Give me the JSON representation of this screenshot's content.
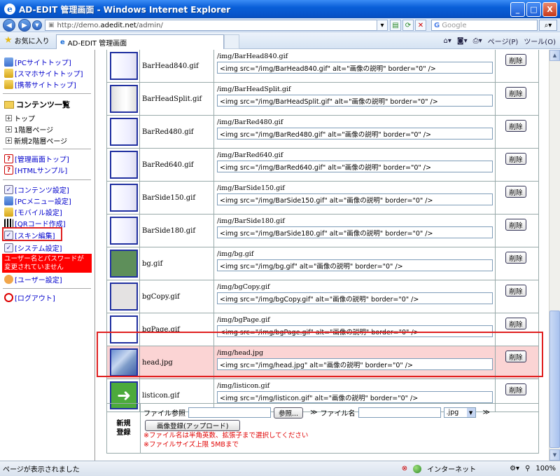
{
  "window": {
    "title": "AD-EDIT 管理画面 - Windows Internet Explorer",
    "min": "_",
    "max": "□",
    "close": "X"
  },
  "address": {
    "url_prefix": "http://demo.",
    "url_domain": "adedit.net",
    "url_suffix": "/admin/",
    "search_placeholder": "Google"
  },
  "favorites": {
    "label": "お気に入り"
  },
  "tab": {
    "label": "AD-EDIT 管理画面"
  },
  "toolbar": {
    "page": "ページ(P)",
    "tools": "ツール(O)"
  },
  "sidebar": {
    "top_links": [
      "[PCサイトトップ]",
      "[スマホサイトトップ]",
      "[携帯サイトトップ]"
    ],
    "contents_title": "コンテンツ一覧",
    "tree": [
      "トップ",
      "1階層ページ",
      "新規2階層ページ"
    ],
    "admin_links": [
      "[管理画面トップ]",
      "[HTMLサンプル]"
    ],
    "settings_links": [
      "[コンテンツ設定]",
      "[PCメニュー設定]",
      "[モバイル設定]",
      "[QRコード作成]",
      "[スキン編集]",
      "[システム設定]"
    ],
    "warning": "ユーザー名とパスワードが変更されていません",
    "user_link": "[ユーザー設定]",
    "logout_link": "[ログアウト]"
  },
  "images": [
    {
      "name": "BarHead840.gif",
      "path": "/img/BarHead840.gif",
      "code": "<img src=\"/img/BarHead840.gif\" alt=\"画像の説明\" border=\"0\" />",
      "thumb": "grad1"
    },
    {
      "name": "BarHeadSplit.gif",
      "path": "/img/BarHeadSplit.gif",
      "code": "<img src=\"/img/BarHeadSplit.gif\" alt=\"画像の説明\" border=\"0\" />",
      "thumb": "split"
    },
    {
      "name": "BarRed480.gif",
      "path": "/img/BarRed480.gif",
      "code": "<img src=\"/img/BarRed480.gif\" alt=\"画像の説明\" border=\"0\" />",
      "thumb": "grad1"
    },
    {
      "name": "BarRed640.gif",
      "path": "/img/BarRed640.gif",
      "code": "<img src=\"/img/BarRed640.gif\" alt=\"画像の説明\" border=\"0\" />",
      "thumb": "grad1"
    },
    {
      "name": "BarSide150.gif",
      "path": "/img/BarSide150.gif",
      "code": "<img src=\"/img/BarSide150.gif\" alt=\"画像の説明\" border=\"0\" />",
      "thumb": "grad1"
    },
    {
      "name": "BarSide180.gif",
      "path": "/img/BarSide180.gif",
      "code": "<img src=\"/img/BarSide180.gif\" alt=\"画像の説明\" border=\"0\" />",
      "thumb": "grad1"
    },
    {
      "name": "bg.gif",
      "path": "/img/bg.gif",
      "code": "<img src=\"/img/bg.gif\" alt=\"画像の説明\" border=\"0\" />",
      "thumb": "green"
    },
    {
      "name": "bgCopy.gif",
      "path": "/img/bgCopy.gif",
      "code": "<img src=\"/img/bgCopy.gif\" alt=\"画像の説明\" border=\"0\" />",
      "thumb": "grey"
    },
    {
      "name": "bgPage.gif",
      "path": "/img/bgPage.gif",
      "code": "<img src=\"/img/bgPage.gif\" alt=\"画像の説明\" border=\"0\" />",
      "thumb": "plain"
    },
    {
      "name": "head.jpg",
      "path": "/img/head.jpg",
      "code": "<img src=\"/img/head.jpg\" alt=\"画像の説明\" border=\"0\" />",
      "thumb": "head",
      "highlighted": true
    },
    {
      "name": "listicon.gif",
      "path": "/img/listicon.gif",
      "code": "<img src=\"/img/listicon.gif\" alt=\"画像の説明\" border=\"0\" />",
      "thumb": "list"
    }
  ],
  "delete_label": "削除",
  "new_registration": {
    "label": "新規登録",
    "file_ref_label": "ファイル参照",
    "browse_label": "参照...",
    "file_name_label": "ファイル名",
    "extension": ".jpg",
    "upload_label": "画像登録(アップロード)",
    "note1": "※ファイル名は半角英数、拡張子まで選択してください",
    "note2": "※ファイルサイズ上限 5MBまで",
    "arrow": "≫"
  },
  "status": {
    "text": "ページが表示されました",
    "zone": "インターネット",
    "zoom": "100%"
  },
  "colors": {
    "highlight_bg": "#fbd4d4",
    "highlight_border": "#e02020",
    "warning_bg": "#ff0000",
    "link": "#0000cc"
  }
}
